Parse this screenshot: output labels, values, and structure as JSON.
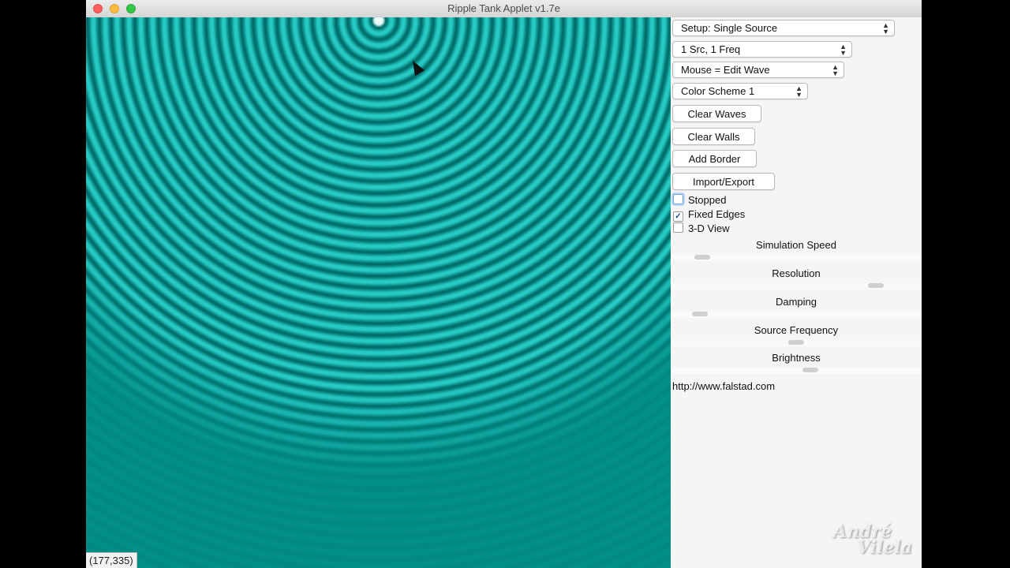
{
  "window": {
    "title": "Ripple Tank Applet v1.7e"
  },
  "canvas": {
    "coordinates": "(177,335)",
    "wave_color": "#27c9c4",
    "background_color": "#008b85"
  },
  "panel": {
    "selects": {
      "setup": "Setup: Single Source",
      "sources": "1 Src, 1 Freq",
      "mouse_mode": "Mouse = Edit Wave",
      "color_scheme": "Color Scheme 1"
    },
    "buttons": {
      "clear_waves": "Clear Waves",
      "clear_walls": "Clear Walls",
      "add_border": "Add Border",
      "import_export": "Import/Export"
    },
    "checkboxes": [
      {
        "label": "Stopped",
        "checked": false
      },
      {
        "label": "Fixed Edges",
        "checked": true
      },
      {
        "label": "3-D View",
        "checked": false
      }
    ],
    "sliders": [
      {
        "label": "Simulation Speed",
        "level": 0.1
      },
      {
        "label": "Resolution",
        "level": 0.84
      },
      {
        "label": "Damping",
        "level": 0.09
      },
      {
        "label": "Source Frequency",
        "level": 0.5
      },
      {
        "label": "Brightness",
        "level": 0.56
      }
    ],
    "url": "http://www.falstad.com"
  },
  "watermark": {
    "line1": "André",
    "line2": "Vilela"
  }
}
